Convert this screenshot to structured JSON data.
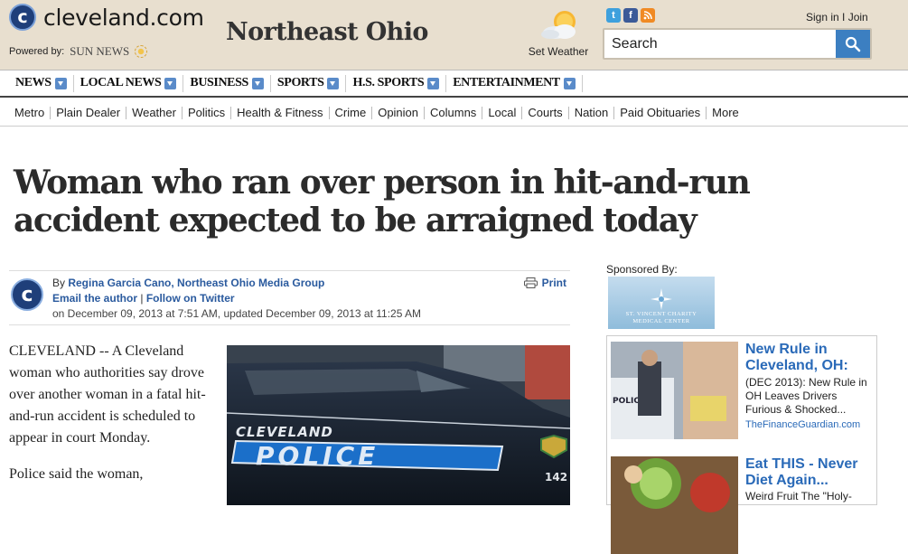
{
  "header": {
    "logo_letter": "c",
    "logo_text": "cleveland.com",
    "powered_by": "Powered by:",
    "sun_news": "SUN NEWS",
    "region": "Northeast Ohio",
    "weather_label": "Set Weather",
    "sign_in": "Sign in I Join",
    "search_placeholder": "Search",
    "social_icons": [
      "twitter-icon",
      "facebook-icon",
      "rss-icon"
    ]
  },
  "nav_primary": {
    "items": [
      "NEWS",
      "LOCAL NEWS",
      "BUSINESS",
      "SPORTS",
      "H.S. SPORTS",
      "ENTERTAINMENT"
    ]
  },
  "nav_secondary": {
    "items": [
      "Metro",
      "Plain Dealer",
      "Weather",
      "Politics",
      "Health & Fitness",
      "Crime",
      "Opinion",
      "Columns",
      "Local",
      "Courts",
      "Nation",
      "Paid Obituaries",
      "More"
    ]
  },
  "article": {
    "headline": "Woman who ran over person in hit-and-run accident expected to be arraigned today",
    "byline_prefix": "By ",
    "author": "Regina Garcia Cano, Northeast Ohio Media Group",
    "email_author": "Email the author",
    "separator": " | ",
    "follow": "Follow on Twitter",
    "date": "on December 09, 2013 at 7:51 AM, updated December 09, 2013 at 11:25 AM",
    "print_label": "Print",
    "paragraphs": [
      "CLEVELAND -- A Cleveland woman who authorities say drove over another woman in a fatal hit-and-run accident is scheduled to appear in court Monday.",
      "Police said the  woman,"
    ],
    "photo": {
      "car_text_top": "CLEVELAND",
      "car_text_main": "POLICE",
      "unit_number": "142"
    }
  },
  "sidebar": {
    "sponsored_by": "Sponsored By:",
    "sponsor_name_line1": "ST. VINCENT CHARITY",
    "sponsor_name_line2": "MEDICAL CENTER",
    "ads": [
      {
        "title": "New Rule in Cleveland, OH:",
        "desc": "(DEC 2013): New Rule in OH Leaves Drivers Furious & Shocked...",
        "source": "TheFinanceGuardian.com",
        "img_text": "POLICE"
      },
      {
        "title": "Eat THIS - Never Diet Again...",
        "desc": "Weird Fruit The \"Holy-"
      }
    ]
  },
  "colors": {
    "header_bg": "#e8dfcf",
    "link_blue": "#2a5a9e",
    "search_button": "#3c7fc1",
    "ad_title": "#2a6ab8"
  }
}
